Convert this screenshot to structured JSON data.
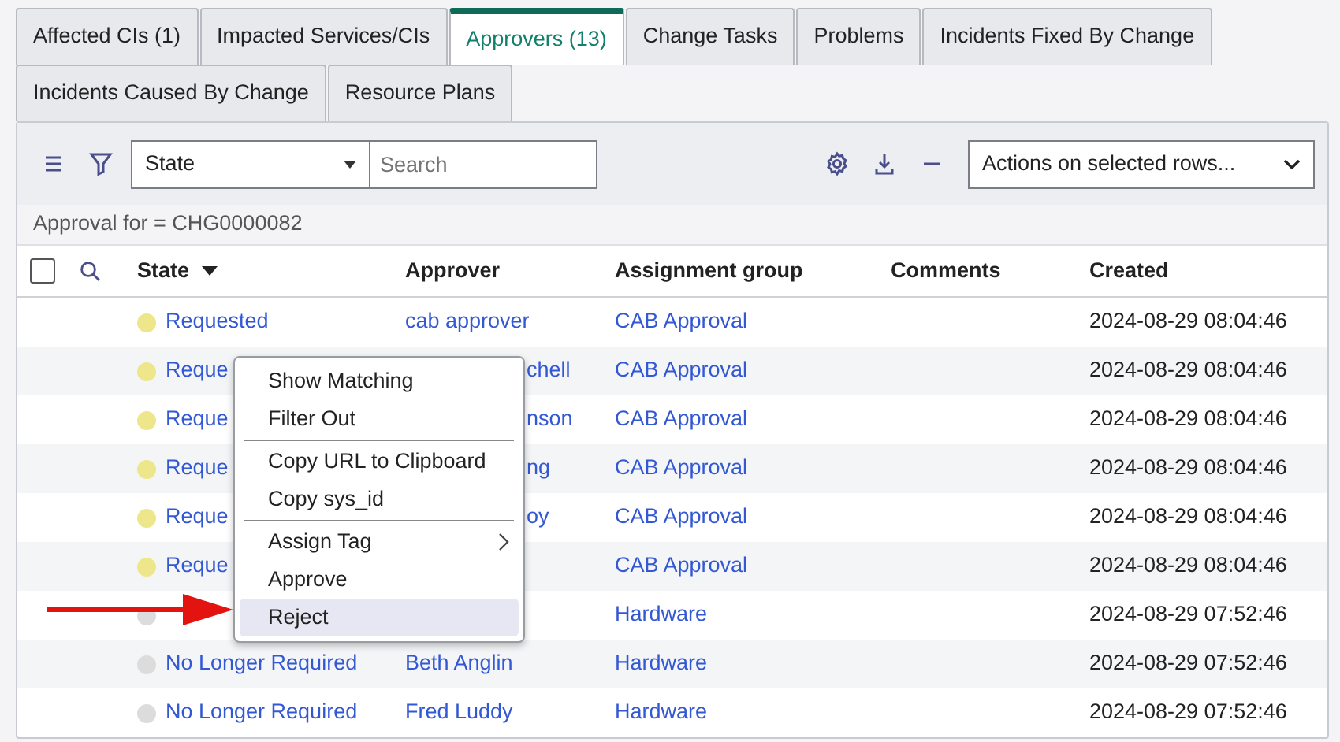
{
  "tabs": [
    {
      "label": "Affected CIs (1)",
      "selected": false
    },
    {
      "label": "Impacted Services/CIs",
      "selected": false
    },
    {
      "label": "Approvers (13)",
      "selected": true
    },
    {
      "label": "Change Tasks",
      "selected": false
    },
    {
      "label": "Problems",
      "selected": false
    },
    {
      "label": "Incidents Fixed By Change",
      "selected": false
    },
    {
      "label": "Incidents Caused By Change",
      "selected": false
    },
    {
      "label": "Resource Plans",
      "selected": false
    }
  ],
  "toolbar": {
    "field_select": "State",
    "search": {
      "placeholder": "Search"
    },
    "actions_select": "Actions on selected rows..."
  },
  "filter_breadcrumb": "Approval for = CHG0000082",
  "table": {
    "select_all": {
      "checked": false
    },
    "columns": [
      "State",
      "Approver",
      "Assignment group",
      "Comments",
      "Created"
    ],
    "rows": [
      {
        "state": "Requested",
        "color": "#ede68a",
        "approver": "cab approver",
        "covered": false,
        "group": "CAB Approval",
        "created": "2024-08-29 08:04:46"
      },
      {
        "state": "Reque",
        "color": "#ede68a",
        "approver": "chell",
        "covered": true,
        "group": "CAB Approval",
        "created": "2024-08-29 08:04:46"
      },
      {
        "state": "Reque",
        "color": "#ede68a",
        "approver": "nson",
        "covered": true,
        "group": "CAB Approval",
        "created": "2024-08-29 08:04:46"
      },
      {
        "state": "Reque",
        "color": "#ede68a",
        "approver": "ng",
        "covered": true,
        "group": "CAB Approval",
        "created": "2024-08-29 08:04:46"
      },
      {
        "state": "Reque",
        "color": "#ede68a",
        "approver": "oy",
        "covered": true,
        "group": "CAB Approval",
        "created": "2024-08-29 08:04:46"
      },
      {
        "state": "Reque",
        "color": "#ede68a",
        "group": "CAB Approval",
        "created": "2024-08-29 08:04:46"
      },
      {
        "color": "#dcdcdc",
        "group": "Hardware",
        "created": "2024-08-29 07:52:46"
      },
      {
        "state": "No Longer Required",
        "color": "#dcdcdc",
        "approver": "Beth Anglin",
        "covered": false,
        "group": "Hardware",
        "created": "2024-08-29 07:52:46"
      },
      {
        "state": "No Longer Required",
        "color": "#dcdcdc",
        "approver": "Fred Luddy",
        "covered": false,
        "group": "Hardware",
        "created": "2024-08-29 07:52:46"
      }
    ]
  },
  "context_menu": [
    {
      "kind": "item",
      "label": "Show Matching",
      "submenu": false,
      "selected": false
    },
    {
      "kind": "item",
      "label": "Filter Out",
      "submenu": false,
      "selected": false
    },
    {
      "kind": "divider"
    },
    {
      "kind": "item",
      "label": "Copy URL to Clipboard",
      "submenu": false,
      "selected": false
    },
    {
      "kind": "item",
      "label": "Copy sys_id",
      "submenu": false,
      "selected": false
    },
    {
      "kind": "divider"
    },
    {
      "kind": "item",
      "label": "Assign Tag",
      "submenu": true,
      "selected": false
    },
    {
      "kind": "item",
      "label": "Approve",
      "submenu": false,
      "selected": false
    },
    {
      "kind": "item",
      "label": "Reject",
      "submenu": false,
      "selected": true
    }
  ]
}
